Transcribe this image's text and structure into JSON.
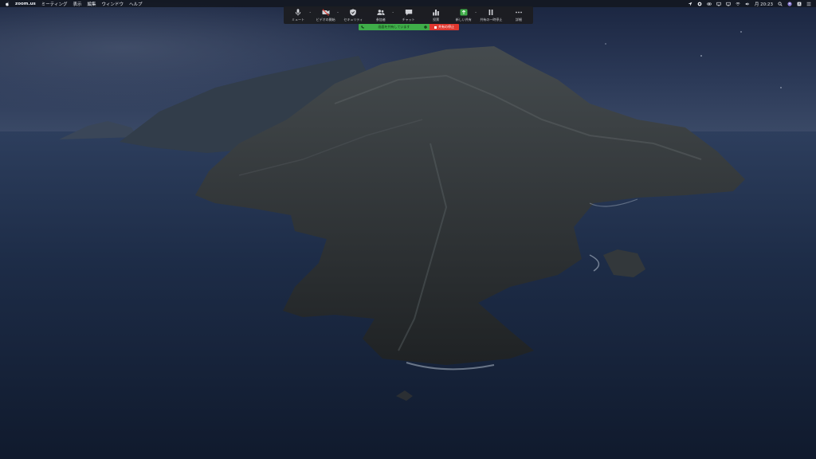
{
  "menubar": {
    "app_name": "zoom.us",
    "items": [
      "ミーティング",
      "表示",
      "編集",
      "ウィンドウ",
      "ヘルプ"
    ],
    "clock": "月 20:23",
    "status_icons": [
      "location-icon",
      "screen-record-icon",
      "link-icon",
      "cast-icon",
      "display-icon",
      "wifi-icon",
      "volume-icon",
      "search-icon",
      "user-icon",
      "notification-icon"
    ]
  },
  "toolbar": {
    "mute_label": "ミュート",
    "video_label": "ビデオの開始",
    "security_label": "セキュリティ",
    "participants_label": "参加者",
    "participants_count": "1",
    "chat_label": "チャット",
    "poll_label": "投票",
    "new_share_label": "新しい共有",
    "pause_share_label": "共有の一時停止",
    "more_label": "詳細"
  },
  "share_status": {
    "sharing_text": "画面を共有しています",
    "stop_label": "共有の停止"
  },
  "colors": {
    "menubar_bg": "#141822",
    "toolbar_bg": "#1c1d21",
    "share_green": "#3fae49",
    "stop_red": "#e0382f",
    "video_off_red": "#e0382f"
  }
}
